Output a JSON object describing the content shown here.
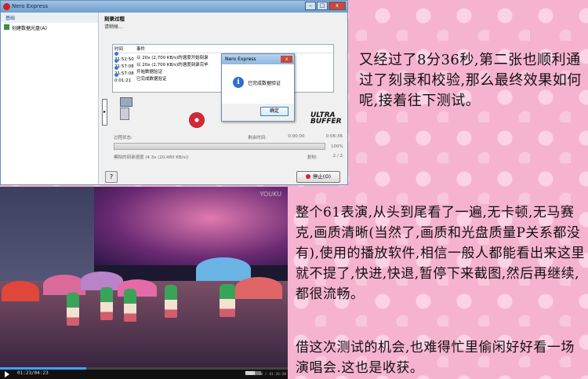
{
  "nero": {
    "title": "Nero Express",
    "left_header": "基础",
    "left_item": "创建数据光盘(A)",
    "section_title": "刻录过程",
    "section_subtitle": "请稍候…",
    "log_headers": [
      "时间",
      "事件"
    ],
    "log_rows": [
      {
        "time": "21:52:50",
        "event": "以 20x (2,700 KB/s)的速度开始刻录"
      },
      {
        "time": "21:57:08",
        "event": "以 20x (2,700 KB/s)的速度刻录完毕"
      },
      {
        "time": "21:57:08",
        "event": "开始数据验证"
      },
      {
        "time": "0:01:21",
        "event": "已完成数据验证"
      }
    ],
    "status_label": "过程状态:",
    "remaining_label": "剩余时间:",
    "remaining_value": "0:00:00",
    "elapsed_value": "0:06:36",
    "progress_percent": "100%",
    "speed_label": "模拟的刻录速度 (4.3x (20,480 KB/s))",
    "copies_label": "复制:",
    "copies_value": "2 / 2",
    "help_symbol": "?",
    "stop_label": "停止(O)",
    "ultra_logo": "ULTRA BUFFER",
    "dialog": {
      "title": "Nero Express",
      "message": "已完成数据验证",
      "ok_label": "确定",
      "info_symbol": "i"
    },
    "window_buttons": {
      "minimize": "–",
      "maximize": "□",
      "close": "x"
    }
  },
  "video": {
    "watermark": "YOUKU",
    "time": "01:23/04:23",
    "right_time": "01:12:40 / 01:26:28",
    "progress": 0.3
  },
  "texts": {
    "p1": "又经过了8分36秒,第二张也顺利通过了刻录和校验,那么最终效果如何呢,接着往下测试。",
    "p2": "整个61表演,从头到尾看了一遍,无卡顿,无马赛克,画质清晰(当然了,画质和光盘质量P关系都没有),使用的播放软件,相信一般人都能看出来这里就不提了,快进,快退,暂停下来截图,然后再继续,都很流畅。",
    "p3": "借这次测试的机会,也难得忙里偷闲好好看一场演唱会.这也是收获。"
  }
}
